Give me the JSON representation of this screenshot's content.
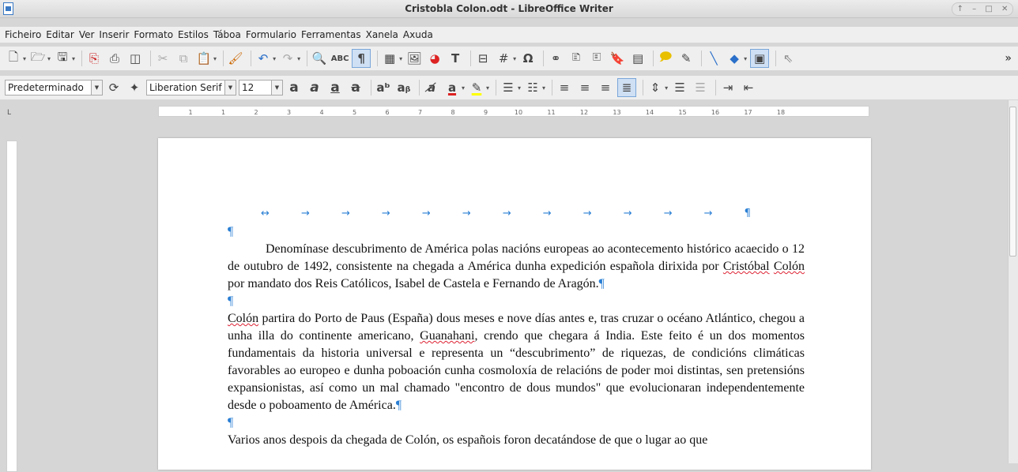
{
  "window": {
    "title": "Cristobla Colon.odt - LibreOffice Writer",
    "controls": [
      "↑",
      "–",
      "□",
      "✕"
    ]
  },
  "menu": {
    "items": [
      "Ficheiro",
      "Editar",
      "Ver",
      "Inserir",
      "Formato",
      "Estilos",
      "Táboa",
      "Formulario",
      "Ferramentas",
      "Xanela",
      "Axuda"
    ]
  },
  "toolbar": {
    "more": "»"
  },
  "formatting": {
    "paragraph_style": "Predeterminado",
    "font_name": "Liberation Serif",
    "font_size": "12"
  },
  "ruler": {
    "corner": "L",
    "ticks": [
      "1",
      "1",
      "2",
      "3",
      "4",
      "5",
      "6",
      "7",
      "8",
      "9",
      "10",
      "11",
      "12",
      "13",
      "14",
      "15",
      "16",
      "17",
      "18"
    ]
  },
  "document": {
    "tab_line_end": "¶",
    "empty_para": "¶",
    "para1": "Denomínase descubrimento de América polas nacións europeas ao acontecemento histórico acaecido o 12 de outubro de 1492, consistente na chegada a América dunha expedición española dirixida por ",
    "para1_w1": "Cristóbal",
    "para1_mid": "  ",
    "para1_w2": "Colón",
    "para1_end": " por mandato dos Reis Católicos, Isabel de Castela e Fernando de Aragón.",
    "para2_w1": "Colón",
    "para2_a": " partira do Porto de Paus (España) dous meses e nove días antes e, tras cruzar o océano Atlántico, chegou a unha illa do continente americano,  ",
    "para2_w2": "Guanahani",
    "para2_b": ", crendo que chegara á India. Este feito é un dos momentos fundamentais da historia universal e representa un “descubrimento” de riquezas, de condicións climáticas favorables ao europeo e dunha poboación cunha  cosmoloxía de relacións de poder moi distintas, sen pretensións  expansionistas, así como un mal chamado \"encontro de dous mundos\" que evolucionaran independentemente desde o  poboamento de América.",
    "para3": "Varios anos despois da chegada de Colón, os españois foron decatándose de que o lugar ao que"
  }
}
